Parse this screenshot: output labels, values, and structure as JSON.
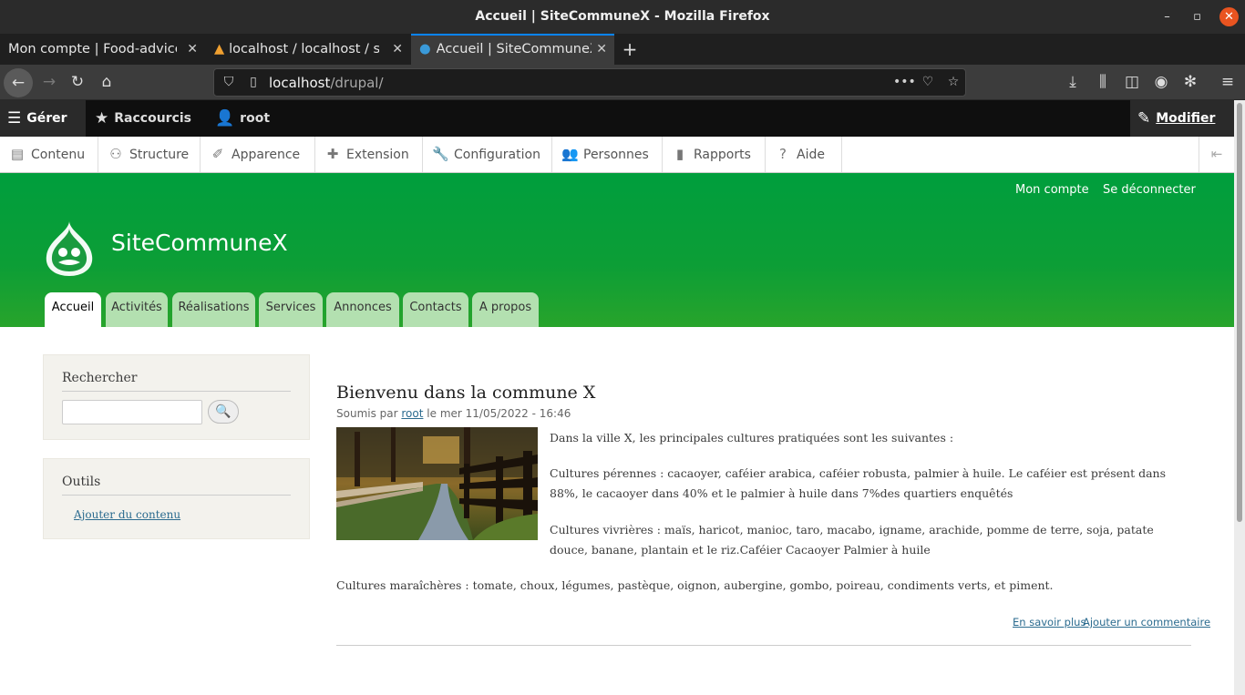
{
  "window": {
    "title": "Accueil | SiteCommuneX - Mozilla Firefox"
  },
  "browser": {
    "tabs": [
      {
        "label": "Mon compte | Food-advice",
        "active": false
      },
      {
        "label": "localhost / localhost / sit",
        "active": false
      },
      {
        "label": "Accueil | SiteCommuneX",
        "active": true
      }
    ],
    "url_host": "localhost",
    "url_path": "/drupal/"
  },
  "admin_toolbar": {
    "manage": "Gérer",
    "shortcuts": "Raccourcis",
    "user": "root",
    "edit": "Modifier"
  },
  "admin_menu": {
    "items": [
      {
        "label": "Contenu",
        "icon": "file-icon"
      },
      {
        "label": "Structure",
        "icon": "sitemap-icon"
      },
      {
        "label": "Apparence",
        "icon": "brush-icon"
      },
      {
        "label": "Extension",
        "icon": "puzzle-icon"
      },
      {
        "label": "Configuration",
        "icon": "wrench-icon"
      },
      {
        "label": "Personnes",
        "icon": "people-icon"
      },
      {
        "label": "Rapports",
        "icon": "bar-chart-icon"
      },
      {
        "label": "Aide",
        "icon": "help-icon"
      }
    ]
  },
  "site": {
    "name": "SiteCommuneX",
    "secondary_menu": [
      "Mon compte",
      "Se déconnecter"
    ],
    "main_menu": [
      "Accueil",
      "Activités",
      "Réalisations",
      "Services",
      "Annonces",
      "Contacts",
      "A propos"
    ],
    "active_tab": "Accueil"
  },
  "sidebar": {
    "search": {
      "title": "Rechercher",
      "value": ""
    },
    "tools": {
      "title": "Outils",
      "link": "Ajouter du contenu"
    }
  },
  "node": {
    "title": "Bienvenu dans la commune X",
    "submitted_prefix": "Soumis par",
    "author": "root",
    "date": "le mer 11/05/2022 - 16:46",
    "paragraphs": [
      "Dans la ville X, les principales cultures pratiquées sont les suivantes :",
      "Cultures pérennes : cacaoyer, caféier arabica, caféier robusta, palmier à huile. Le caféier est présent dans 88%, le cacaoyer dans 40% et le palmier à huile dans 7%des quartiers enquêtés",
      "Cultures vivrières : maïs, haricot, manioc, taro, macabo, igname, arachide, pomme de terre, soja, patate douce, banane, plantain et le riz.Caféier Cacaoyer Palmier à huile",
      "Cultures maraîchères : tomate, choux, légumes, pastèque, oignon, aubergine, gombo, poireau, condiments verts, et piment."
    ],
    "links": [
      "En savoir plus",
      "Ajouter un commentaire"
    ]
  },
  "colors": {
    "header_green": "#009e3d",
    "tab_green": "#b3e0b0",
    "link_blue": "#2b6b8f"
  }
}
